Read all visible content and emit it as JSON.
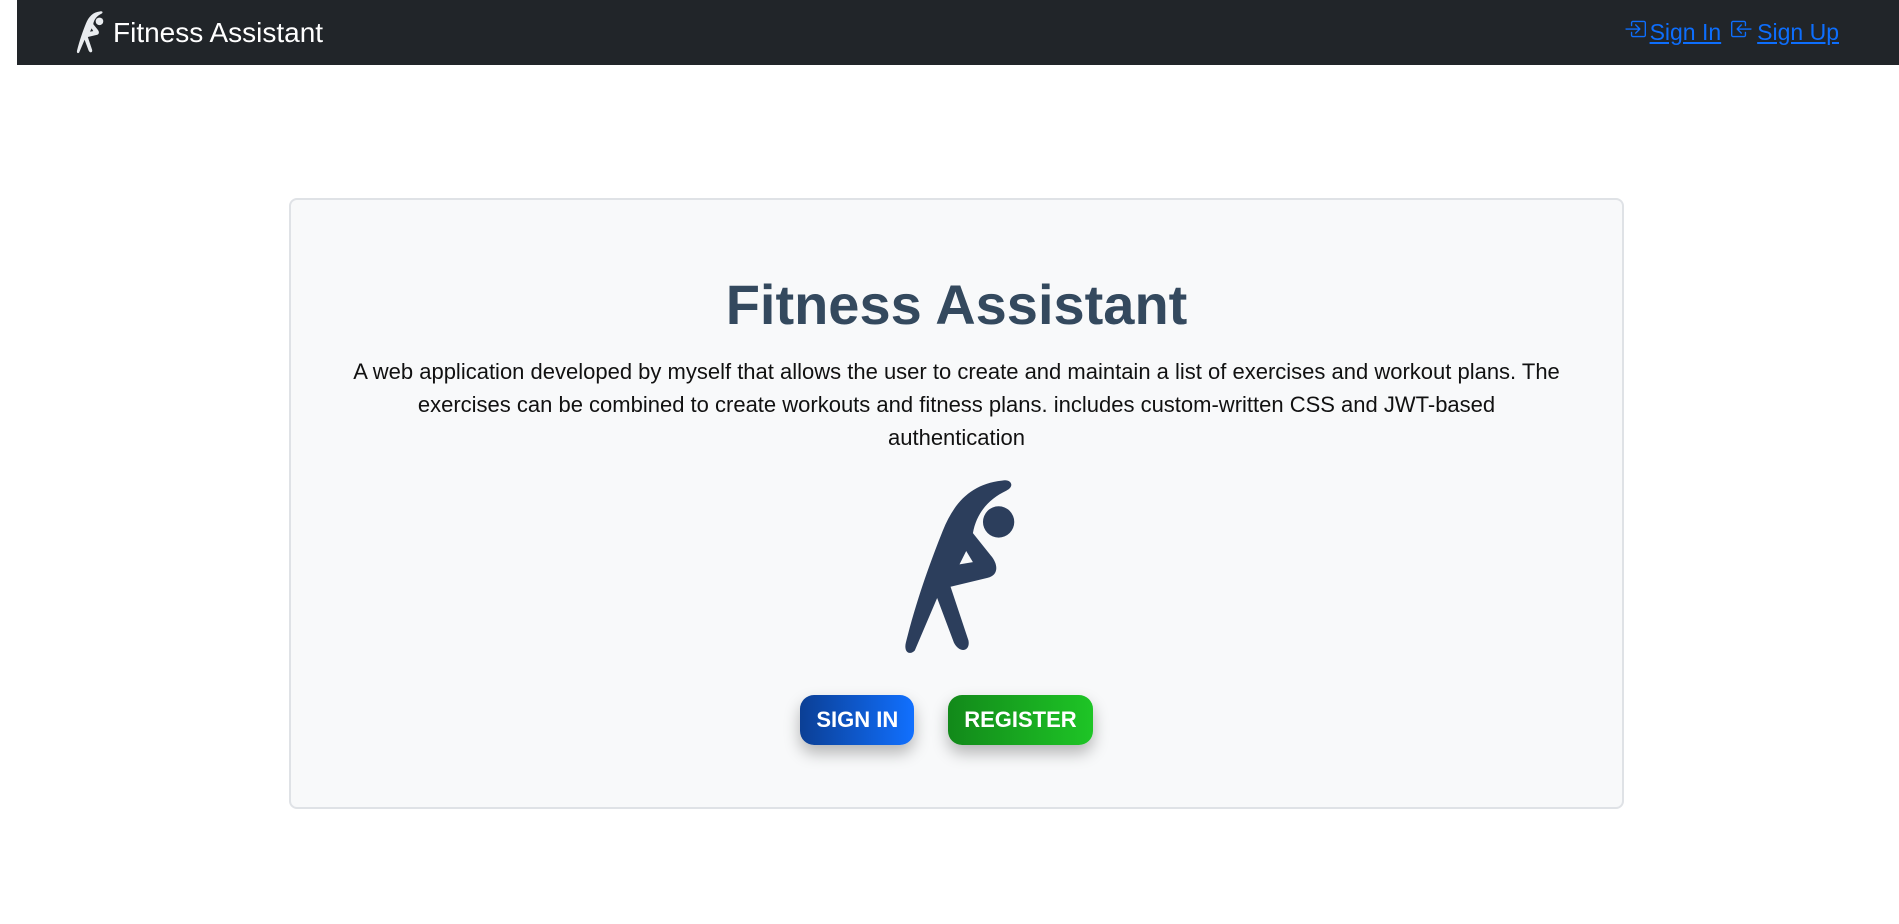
{
  "navbar": {
    "brand_icon": "stretching-person-icon",
    "brand_label": "Fitness Assistant",
    "links": [
      {
        "label": "Sign In",
        "icon": "sign-in-icon"
      },
      {
        "label": "Sign Up",
        "icon": "sign-up-icon"
      }
    ],
    "background_color": "#212529",
    "link_color": "#0d6efd"
  },
  "hero": {
    "title": "Fitness Assistant",
    "description": "A web application developed by myself that allows the user to create and maintain a list of exercises and workout plans. The exercises can be combined to create workouts and fitness plans. includes custom-written CSS and JWT-based authentication",
    "figure_icon": "stretching-person-icon",
    "title_color": "#34495e",
    "buttons": {
      "signin_label": "SIGN IN",
      "register_label": "REGISTER"
    }
  }
}
